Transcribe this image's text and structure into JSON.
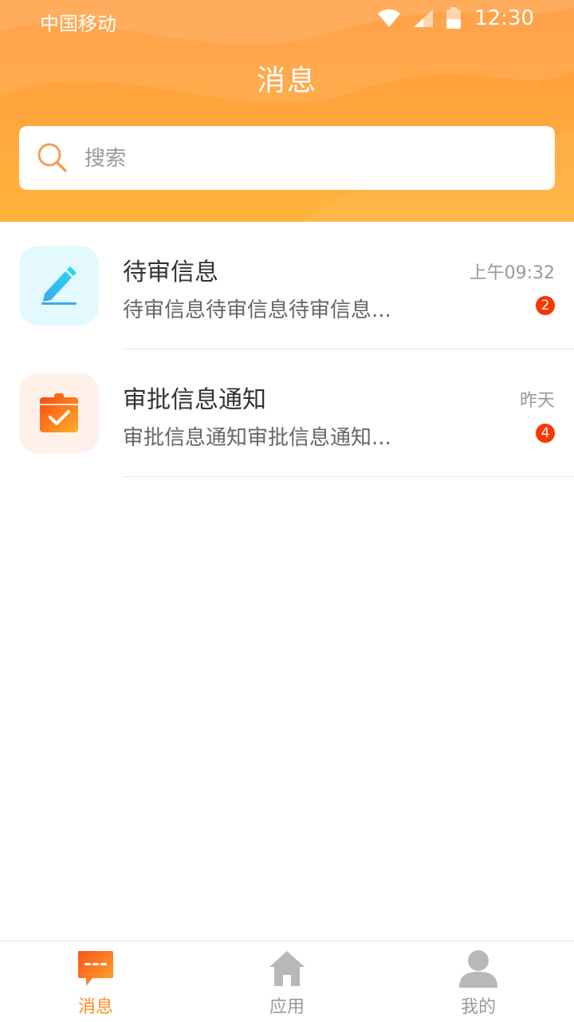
{
  "status_bar": {
    "carrier": "中国移动",
    "time": "12:30",
    "icons": [
      "wifi-icon",
      "signal-icon",
      "battery-icon"
    ]
  },
  "header": {
    "title": "消息"
  },
  "search": {
    "placeholder": "搜索",
    "value": ""
  },
  "messages": [
    {
      "title": "待审信息",
      "preview": "待审信息待审信息待审信息...",
      "time": "上午09:32",
      "badge": "2",
      "icon": "edit-pencil-icon"
    },
    {
      "title": "审批信息通知",
      "preview": "审批信息通知审批信息通知...",
      "time": "昨天",
      "badge": "4",
      "icon": "calendar-check-icon"
    }
  ],
  "tabbar": {
    "tabs": [
      {
        "label": "消息",
        "icon": "chat-icon",
        "active": true
      },
      {
        "label": "应用",
        "icon": "home-icon",
        "active": false
      },
      {
        "label": "我的",
        "icon": "user-icon",
        "active": false
      }
    ]
  },
  "colors": {
    "header_gradient_top": "#ff9a3c",
    "header_gradient_bottom": "#ffb43c",
    "badge": "#f83600",
    "title_text": "#333333",
    "preview_text": "#666666",
    "time_text": "#999999",
    "divider": "#e6e6e6",
    "active_tab": "#ff8a1e",
    "inactive_tab": "#999999"
  }
}
